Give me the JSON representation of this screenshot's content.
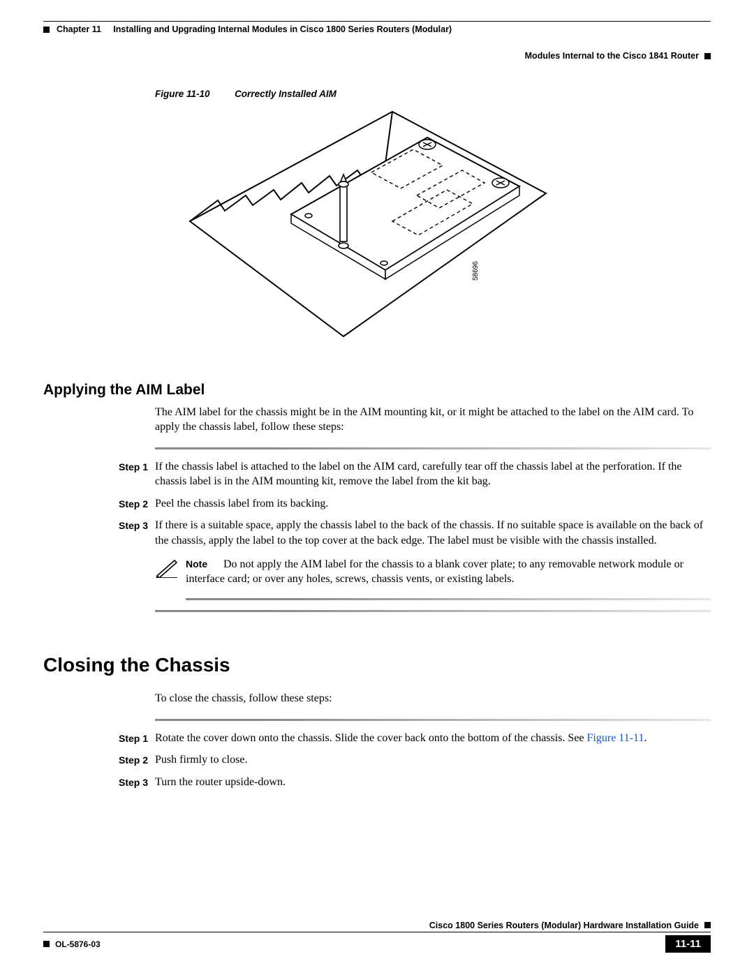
{
  "header": {
    "chapter": "Chapter 11",
    "chapter_title": "Installing and Upgrading Internal Modules in Cisco 1800 Series Routers (Modular)",
    "section": "Modules Internal to the Cisco 1841 Router"
  },
  "figure": {
    "label": "Figure 11-10",
    "title": "Correctly Installed AIM",
    "art_number": "58696"
  },
  "section1": {
    "heading": "Applying the AIM Label",
    "intro": "The AIM label for the chassis might be in the AIM mounting kit, or it might be attached to the label on the AIM card. To apply the chassis label, follow these steps:",
    "steps": [
      {
        "label": "Step 1",
        "text": "If the chassis label is attached to the label on the AIM card, carefully tear off the chassis label at the perforation. If the chassis label is in the AIM mounting kit, remove the label from the kit bag."
      },
      {
        "label": "Step 2",
        "text": "Peel the chassis label from its backing."
      },
      {
        "label": "Step 3",
        "text": "If there is a suitable space, apply the chassis label to the back of the chassis. If no suitable space is available on the back of the chassis, apply the label to the top cover at the back edge. The label must be visible with the chassis installed."
      }
    ],
    "note": {
      "label": "Note",
      "text": "Do not apply the AIM label for the chassis to a blank cover plate; to any removable network module or interface card; or over any holes, screws, chassis vents, or existing labels."
    }
  },
  "section2": {
    "heading": "Closing the Chassis",
    "intro": "To close the chassis, follow these steps:",
    "steps": [
      {
        "label": "Step 1",
        "text_a": "Rotate the cover down onto the chassis. Slide the cover back onto the bottom of the chassis. See ",
        "link": "Figure 11-11",
        "text_b": "."
      },
      {
        "label": "Step 2",
        "text": "Push firmly to close."
      },
      {
        "label": "Step 3",
        "text": "Turn the router upside-down."
      }
    ]
  },
  "footer": {
    "guide": "Cisco 1800 Series Routers (Modular) Hardware Installation Guide",
    "doc": "OL-5876-03",
    "page": "11-11"
  }
}
